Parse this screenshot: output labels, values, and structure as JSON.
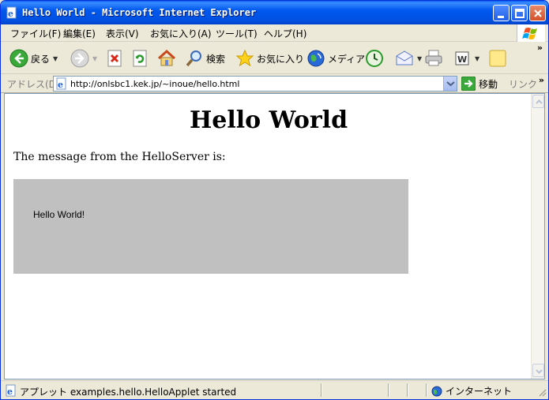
{
  "window": {
    "title": "Hello World - Microsoft Internet Explorer"
  },
  "menu": [
    "ファイル(F)",
    "編集(E)",
    "表示(V)",
    "お気に入り(A)",
    "ツール(T)",
    "ヘルプ(H)"
  ],
  "toolbar": {
    "back_label": "戻る",
    "search_label": "検索",
    "favorites_label": "お気に入り",
    "media_label": "メディア"
  },
  "address": {
    "label": "アドレス(D)",
    "url": "http://onlsbc1.kek.jp/~inoue/hello.html",
    "go_label": "移動",
    "links_label": "リンク"
  },
  "page": {
    "heading": "Hello World",
    "message": "The message from the HelloServer is:",
    "applet_text": "Hello World!"
  },
  "status": {
    "text": "アプレット examples.hello.HelloApplet started",
    "zone": "インターネット"
  },
  "colors": {
    "titlebar": "#0058ee",
    "applet_bg": "#c0c0c0"
  }
}
